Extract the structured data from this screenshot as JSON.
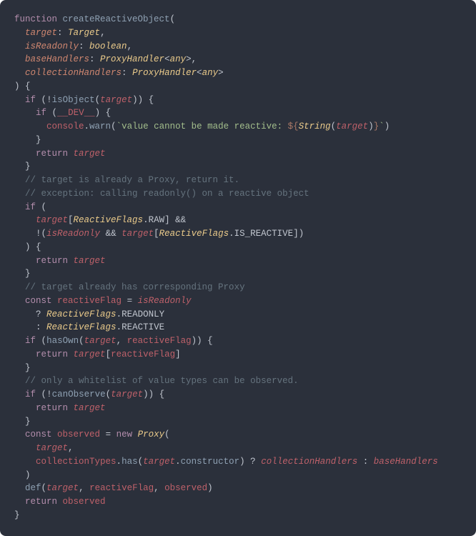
{
  "code": {
    "l1": {
      "kw_function": "function",
      "fn": "createReactiveObject",
      "p": "("
    },
    "l2": {
      "param": "target",
      "type": "Target"
    },
    "l3": {
      "param": "isReadonly",
      "type": "boolean"
    },
    "l4": {
      "param": "baseHandlers",
      "type1": "ProxyHandler",
      "lt": "<",
      "type2": "any",
      "gt": ">"
    },
    "l5": {
      "param": "collectionHandlers",
      "type1": "ProxyHandler",
      "lt": "<",
      "type2": "any",
      "gt": ">"
    },
    "l6": {
      "close": ") {"
    },
    "l7": {
      "kw_if": "if",
      "bang": "!",
      "fn": "isObject",
      "arg": "target"
    },
    "l8": {
      "kw_if": "if",
      "var": "__DEV__"
    },
    "l9": {
      "obj": "console",
      "fn": "warn",
      "str1": "`value cannot be made reactive: ",
      "tpl_open": "${",
      "cast": "String",
      "arg": "target",
      "tpl_close": "}",
      "str2": "`"
    },
    "l10": {
      "brace": "}"
    },
    "l11": {
      "kw_return": "return",
      "var": "target"
    },
    "l12": {
      "brace": "}"
    },
    "l13": {
      "comment": "// target is already a Proxy, return it."
    },
    "l14": {
      "comment": "// exception: calling readonly() on a reactive object"
    },
    "l15": {
      "kw_if": "if",
      "open": "("
    },
    "l16": {
      "var1": "target",
      "type": "ReactiveFlags",
      "prop": "RAW",
      "amp": "&&"
    },
    "l17": {
      "bang": "!(",
      "var1": "isReadonly",
      "amp": "&&",
      "var2": "target",
      "type": "ReactiveFlags",
      "prop": "IS_REACTIVE",
      "close": "])"
    },
    "l18": {
      "close": ") {"
    },
    "l19": {
      "kw_return": "return",
      "var": "target"
    },
    "l20": {
      "brace": "}"
    },
    "l21": {
      "comment": "// target already has corresponding Proxy"
    },
    "l22": {
      "kw_const": "const",
      "name": "reactiveFlag",
      "eq": "=",
      "var": "isReadonly"
    },
    "l23": {
      "q": "?",
      "type": "ReactiveFlags",
      "prop": "READONLY"
    },
    "l24": {
      "q": ":",
      "type": "ReactiveFlags",
      "prop": "REACTIVE"
    },
    "l25": {
      "kw_if": "if",
      "fn": "hasOwn",
      "arg1": "target",
      "arg2": "reactiveFlag"
    },
    "l26": {
      "kw_return": "return",
      "var": "target",
      "idx": "reactiveFlag"
    },
    "l27": {
      "brace": "}"
    },
    "l28": {
      "comment": "// only a whitelist of value types can be observed."
    },
    "l29": {
      "kw_if": "if",
      "bang": "!",
      "fn": "canObserve",
      "arg": "target"
    },
    "l30": {
      "kw_return": "return",
      "var": "target"
    },
    "l31": {
      "brace": "}"
    },
    "l32": {
      "kw_const": "const",
      "name": "observed",
      "eq": "=",
      "kw_new": "new",
      "cls": "Proxy",
      "open": "("
    },
    "l33": {
      "arg": "target",
      "comma": ","
    },
    "l34": {
      "obj": "collectionTypes",
      "fn": "has",
      "arg": "target",
      "prop": "constructor",
      "q": "?",
      "a": "collectionHandlers",
      "colon": ":",
      "b": "baseHandlers"
    },
    "l35": {
      "close": ")"
    },
    "l36": {
      "fn": "def",
      "a1": "target",
      "a2": "reactiveFlag",
      "a3": "observed"
    },
    "l37": {
      "kw_return": "return",
      "var": "observed"
    },
    "l38": {
      "brace": "}"
    }
  }
}
